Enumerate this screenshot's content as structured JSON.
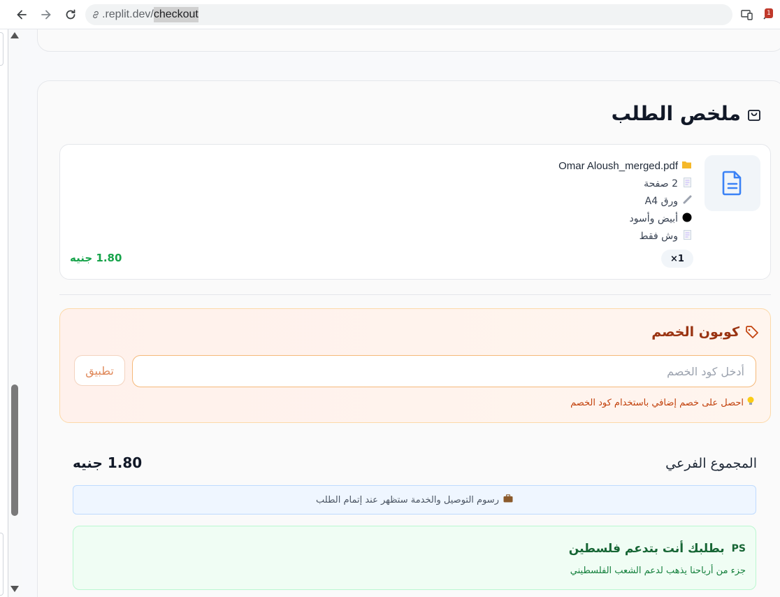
{
  "browser": {
    "url_host": ".replit.dev/",
    "url_path": "checkout",
    "extension_badge": "1"
  },
  "summary": {
    "title": "ملخص الطلب"
  },
  "item": {
    "file_name": "Omar Aloush_merged.pdf",
    "pages": "2 صفحة",
    "paper": "ورق A4",
    "color_mode": "أبيض وأسود",
    "sides": "وش فقط",
    "quantity": "×1",
    "price": "1.80 جنيه"
  },
  "coupon": {
    "title": "كوبون الخصم",
    "placeholder": "أدخل كود الخصم",
    "apply_label": "تطبيق",
    "hint": "احصل على خصم إضافي باستخدام كود الخصم"
  },
  "totals": {
    "subtotal_label": "المجموع الفرعي",
    "subtotal_value": "1.80 جنيه",
    "fees_note": "رسوم التوصيل والخدمة ستظهر عند إتمام الطلب"
  },
  "palestine": {
    "badge": "PS",
    "title": "بطلبك أنت بتدعم فلسطين",
    "subtitle": "جزء من أرباحنا يذهب لدعم الشعب الفلسطيني"
  },
  "colors": {
    "accent_green": "#16a34a",
    "coupon_orange": "#c2410c",
    "file_icon_blue": "#3b82f6"
  }
}
